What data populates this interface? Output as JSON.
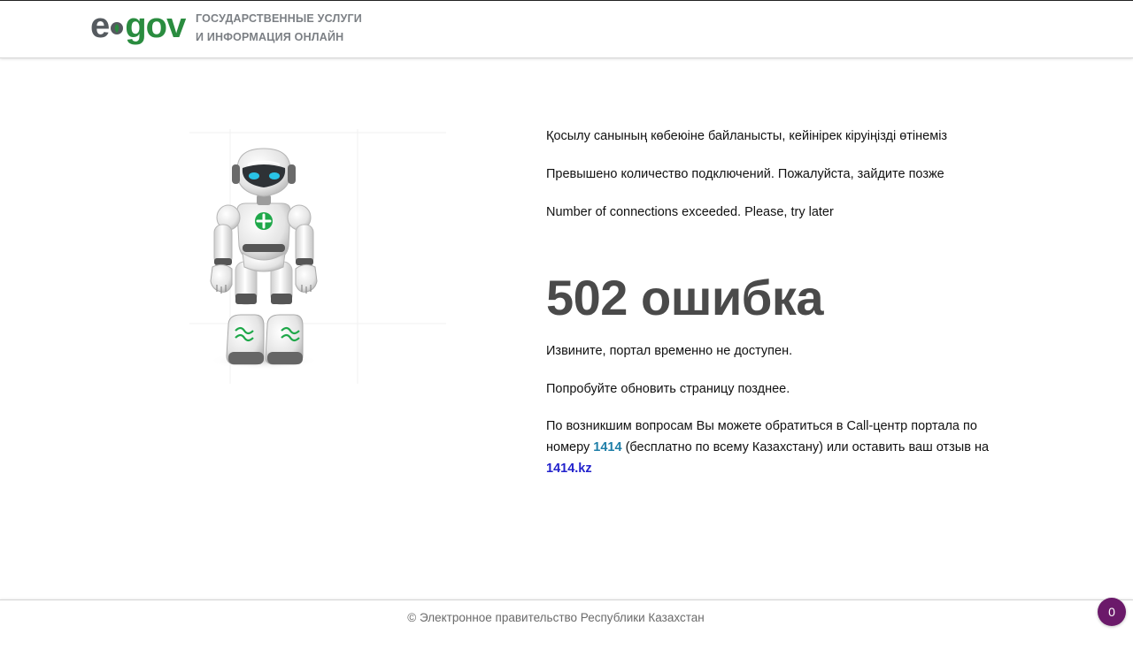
{
  "header": {
    "logo": {
      "part_e": "e",
      "part_gov": "gov",
      "brand_color": "#2a8c3f",
      "grey_color": "#555a5f"
    },
    "tagline": {
      "line1": "ГОСУДАРСТВЕННЫЕ УСЛУГИ",
      "line2": "И ИНФОРМАЦИЯ ОНЛАЙН"
    }
  },
  "illustration": {
    "icon": "robot-icon"
  },
  "messages": {
    "kz": "Қосылу санының көбеюіне байланысты, кейінірек кіруіңізді өтінеміз",
    "ru": "Превышено количество подключений. Пожалуйста, зайдите позже",
    "en": "Number of connections exceeded. Please, try later"
  },
  "error": {
    "title": "502 ошибка"
  },
  "details": {
    "line1": "Извините, портал временно не доступен.",
    "line2": "Попробуйте обновить страницу позднее.",
    "contact_prefix": "По возникшим вопросам Вы можете обратиться в Call-центр портала по номеру ",
    "call_number": "1414",
    "contact_middle": " (бесплатно по всему Казахстану) или оставить ваш отзыв на ",
    "feedback_link": "1414.kz"
  },
  "footer": {
    "copyright": "© Электронное правительство Республики Казахстан"
  },
  "badge": {
    "count": "0",
    "color": "#6b1a6a"
  },
  "colors": {
    "title_grey": "#4a4a4a",
    "link_teal": "#1f7fa8",
    "link_blue": "#2222cc"
  }
}
